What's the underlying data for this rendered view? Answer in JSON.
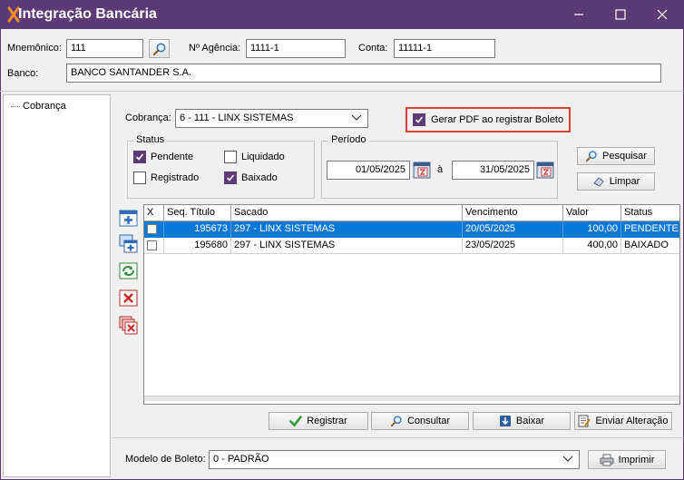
{
  "window": {
    "title": "Integração Bancária"
  },
  "header": {
    "mnemonico_label": "Mnemônico:",
    "mnemonico_value": "111",
    "agencia_label": "Nº Agência:",
    "agencia_value": "1111-1",
    "conta_label": "Conta:",
    "conta_value": "11111-1",
    "banco_label": "Banco:",
    "banco_value": "BANCO SANTANDER S.A."
  },
  "tree": {
    "items": [
      {
        "label": "Cobrança"
      }
    ]
  },
  "filters": {
    "cobranca_label": "Cobrança:",
    "cobranca_value": "6 - 111 - LINX SISTEMAS",
    "gerar_pdf_label": "Gerar PDF ao registrar Boleto",
    "gerar_pdf_checked": true,
    "status_title": "Status",
    "status": [
      {
        "label": "Pendente",
        "checked": true
      },
      {
        "label": "Liquidado",
        "checked": false
      },
      {
        "label": "Registrado",
        "checked": false
      },
      {
        "label": "Baixado",
        "checked": true
      }
    ],
    "periodo_title": "Período",
    "periodo_de": "01/05/2025",
    "periodo_sep": "à",
    "periodo_ate": "31/05/2025",
    "pesquisar_label": "Pesquisar",
    "limpar_label": "Limpar"
  },
  "grid": {
    "columns": [
      "X",
      "Seq. Título",
      "Sacado",
      "Vencimento",
      "Valor",
      "Status"
    ],
    "rows": [
      {
        "seq": "195673",
        "sacado": "297 - LINX SISTEMAS",
        "vencimento": "20/05/2025",
        "valor": "100,00",
        "status": "PENDENTE",
        "selected": true
      },
      {
        "seq": "195680",
        "sacado": "297 - LINX SISTEMAS",
        "vencimento": "23/05/2025",
        "valor": "400,00",
        "status": "BAIXADO",
        "selected": false
      }
    ]
  },
  "actions": {
    "registrar": "Registrar",
    "consultar": "Consultar",
    "baixar": "Baixar",
    "enviar_alteracao": "Enviar Alteração"
  },
  "footer": {
    "modelo_label": "Modelo de Boleto:",
    "modelo_value": "0 - PADRÃO",
    "imprimir": "Imprimir"
  },
  "colors": {
    "titlebar": "#5c3a75",
    "selection": "#0a78d7",
    "highlight_border": "#e03c31"
  }
}
